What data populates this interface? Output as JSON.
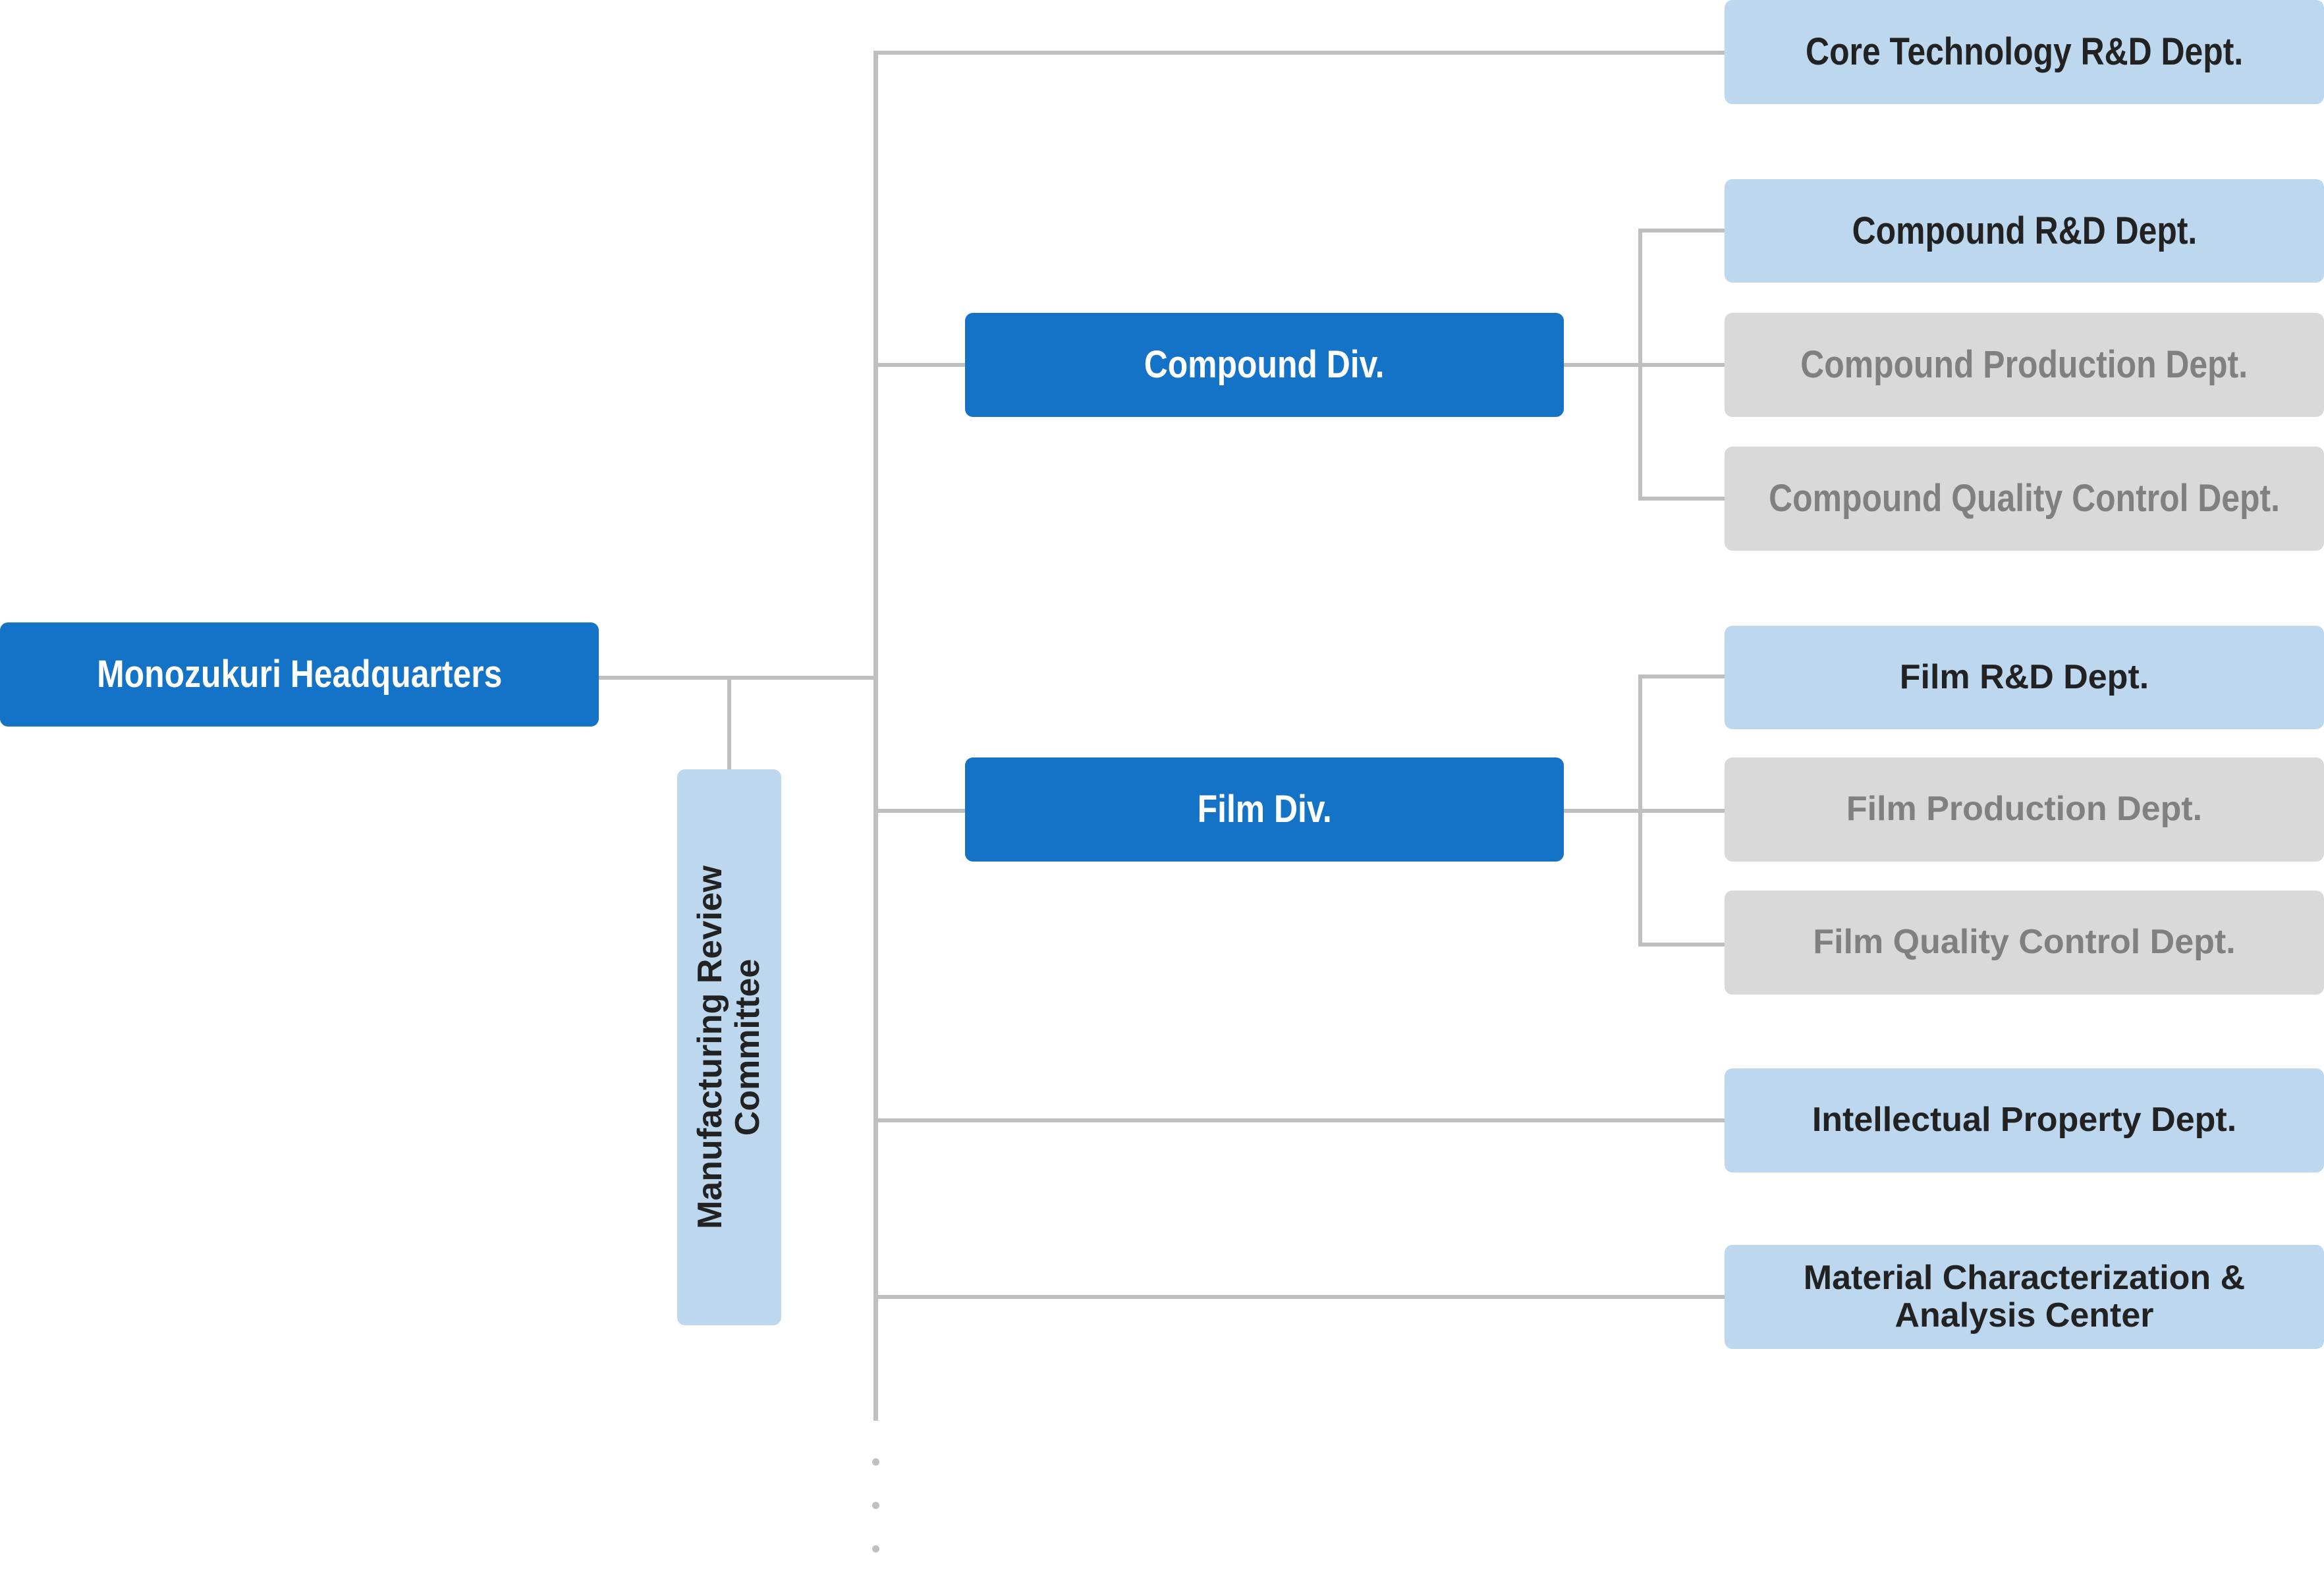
{
  "headquarters": {
    "label": "Monozukuri Headquarters"
  },
  "committee": {
    "line1": "Manufacturing Review",
    "line2": "Committee"
  },
  "divisions": {
    "compound": {
      "label": "Compound Div."
    },
    "film": {
      "label": "Film Div."
    }
  },
  "departments": {
    "core_technology": {
      "label": "Core Technology R&D Dept.",
      "status": "active"
    },
    "compound_rd": {
      "label": "Compound R&D Dept.",
      "status": "active"
    },
    "compound_production": {
      "label": "Compound Production Dept.",
      "status": "inactive"
    },
    "compound_qc": {
      "label": "Compound Quality Control Dept.",
      "status": "inactive"
    },
    "film_rd": {
      "label": "Film R&D Dept.",
      "status": "active"
    },
    "film_production": {
      "label": "Film Production Dept.",
      "status": "inactive"
    },
    "film_qc": {
      "label": "Film Quality Control Dept.",
      "status": "inactive"
    },
    "intellectual_property": {
      "label": "Intellectual Property Dept.",
      "status": "active"
    },
    "material_center": {
      "line1": "Material Characterization &",
      "line2": "Analysis Center",
      "status": "active"
    }
  },
  "continuation": {
    "indicator": "more-items-ellipsis"
  },
  "colors": {
    "primary": "#1473c6",
    "highlight": "#bdd7ee",
    "muted": "#d9d9d9",
    "connector": "#bfbfbf",
    "muted_text": "#808080",
    "dark_text": "#222222"
  }
}
